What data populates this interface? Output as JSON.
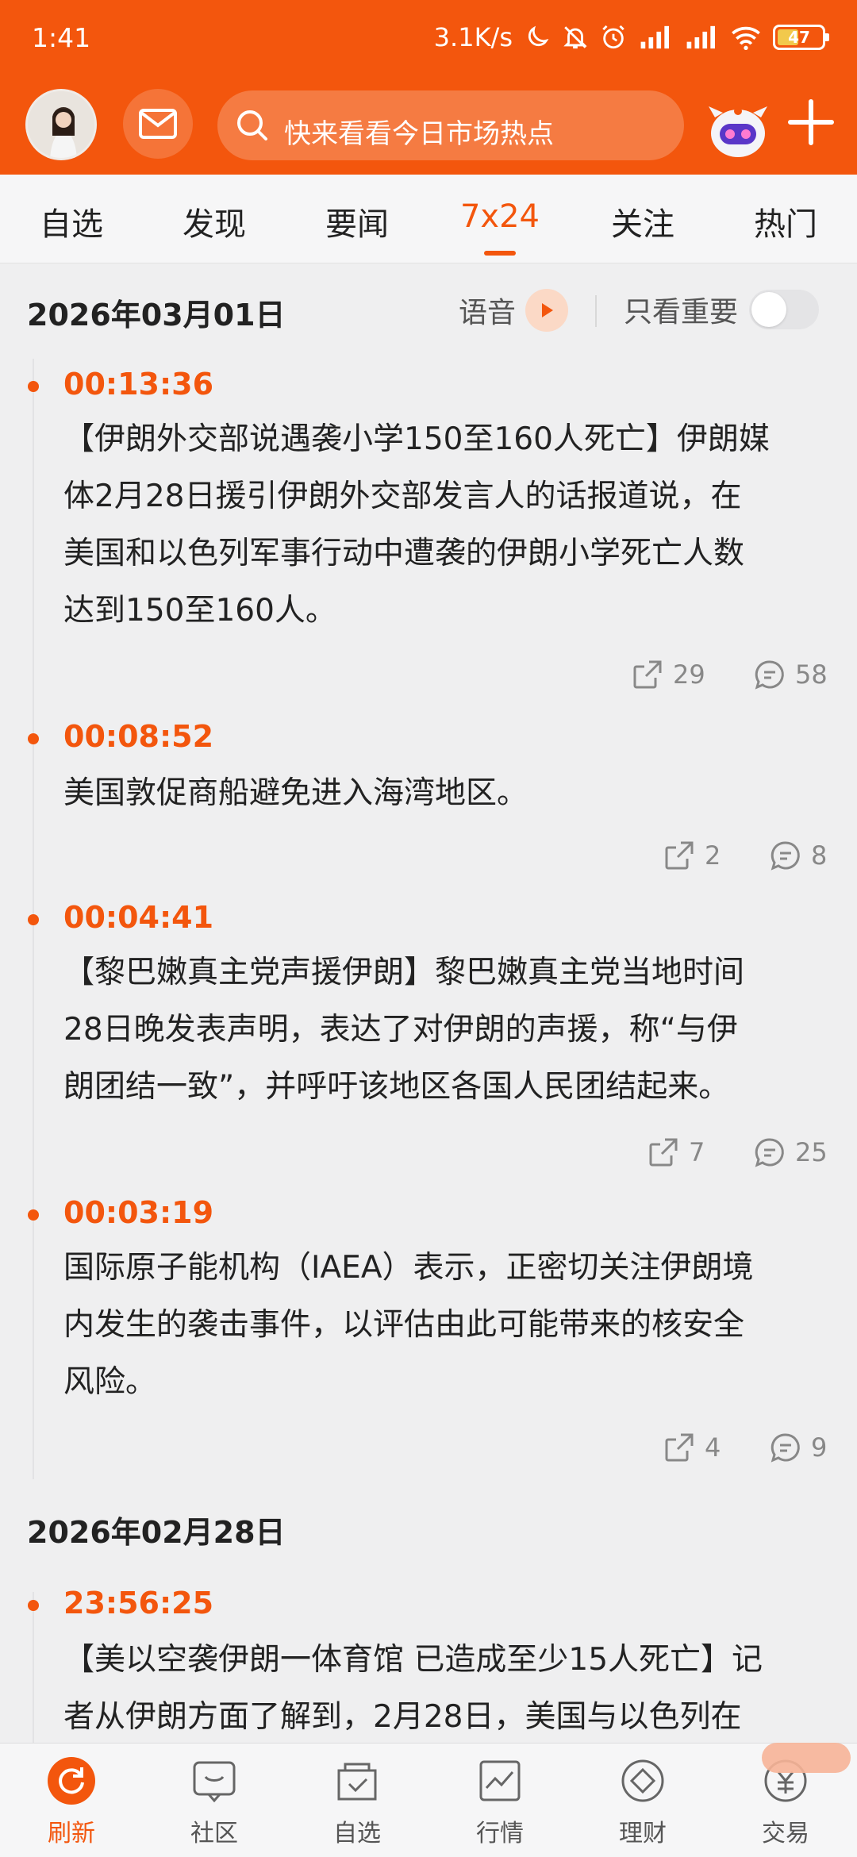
{
  "status_bar": {
    "time": "1:41",
    "network_speed": "3.1K/s",
    "battery": "47"
  },
  "header": {
    "search_placeholder": "快来看看今日市场热点"
  },
  "tabs": [
    {
      "label": "自选"
    },
    {
      "label": "发现"
    },
    {
      "label": "要闻"
    },
    {
      "label": "7x24",
      "active": true
    },
    {
      "label": "关注"
    },
    {
      "label": "热门"
    }
  ],
  "controls": {
    "voice_label": "语音",
    "important_label": "只看重要",
    "important_only": false
  },
  "feed": [
    {
      "date": "2026年03月01日",
      "items": [
        {
          "time": "00:13:36",
          "lines": [
            "【伊朗外交部说遇袭小学150至160人死亡】伊朗媒",
            "体2月28日援引伊朗外交部发言人的话报道说，在",
            "美国和以色列军事行动中遭袭的伊朗小学死亡人数",
            "达到150至160人。"
          ],
          "shares": "29",
          "comments": "58"
        },
        {
          "time": "00:08:52",
          "lines": [
            "美国敦促商船避免进入海湾地区。"
          ],
          "shares": "2",
          "comments": "8"
        },
        {
          "time": "00:04:41",
          "lines": [
            "【黎巴嫩真主党声援伊朗】黎巴嫩真主党当地时间",
            "28日晚发表声明，表达了对伊朗的声援，称“与伊",
            "朗团结一致”，并呼吁该地区各国人民团结起来。"
          ],
          "shares": "7",
          "comments": "25"
        },
        {
          "time": "00:03:19",
          "lines": [
            "国际原子能机构（IAEA）表示，正密切关注伊朗境",
            "内发生的袭击事件，以评估由此可能带来的核安全",
            "风险。"
          ],
          "shares": "4",
          "comments": "9"
        }
      ]
    },
    {
      "date": "2026年02月28日",
      "items": [
        {
          "time": "23:56:25",
          "lines": [
            "【美以空袭伊朗一体育馆 已造成至少15人死亡】记",
            "者从伊朗方面了解到，2月28日，美国与以色列在"
          ]
        }
      ]
    }
  ],
  "bottom_nav": [
    {
      "label": "刷新",
      "icon": "refresh-icon",
      "active": true
    },
    {
      "label": "社区",
      "icon": "community-icon"
    },
    {
      "label": "自选",
      "icon": "watchlist-icon"
    },
    {
      "label": "行情",
      "icon": "market-icon"
    },
    {
      "label": "理财",
      "icon": "wealth-icon"
    },
    {
      "label": "交易",
      "icon": "trade-icon"
    }
  ],
  "colors": {
    "brand": "#f3560d",
    "background": "#efeff0"
  }
}
